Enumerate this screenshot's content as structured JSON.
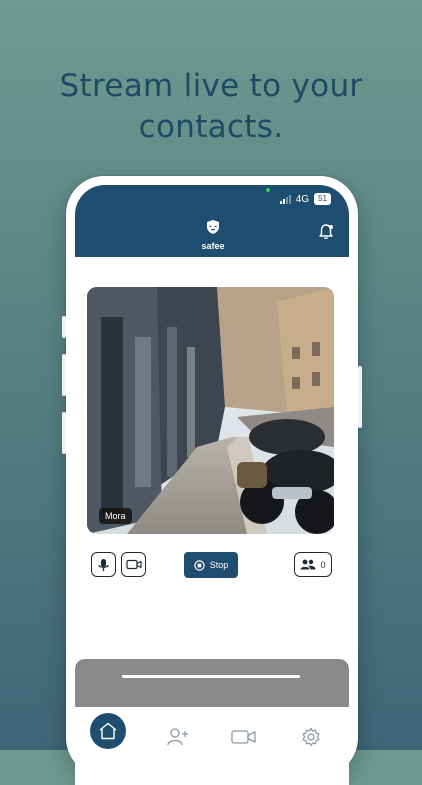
{
  "headline": {
    "line1": "Stream live to your",
    "line2": "contacts."
  },
  "status_bar": {
    "network": "4G",
    "battery": "51"
  },
  "app": {
    "name": "safee"
  },
  "video": {
    "contact_name": "Mora"
  },
  "controls": {
    "stop_label": "Stop",
    "viewer_count": "0"
  },
  "tabs": [
    {
      "name": "home",
      "icon": "home-icon",
      "active": true
    },
    {
      "name": "add-contact",
      "icon": "add-user-icon",
      "active": false
    },
    {
      "name": "video",
      "icon": "video-camera-icon",
      "active": false
    },
    {
      "name": "settings",
      "icon": "gear-icon",
      "active": false
    }
  ],
  "colors": {
    "brand_navy": "#1f4d70",
    "headline": "#1f4a63",
    "background_top": "#6e9a90",
    "background_bottom": "#3f6577"
  }
}
